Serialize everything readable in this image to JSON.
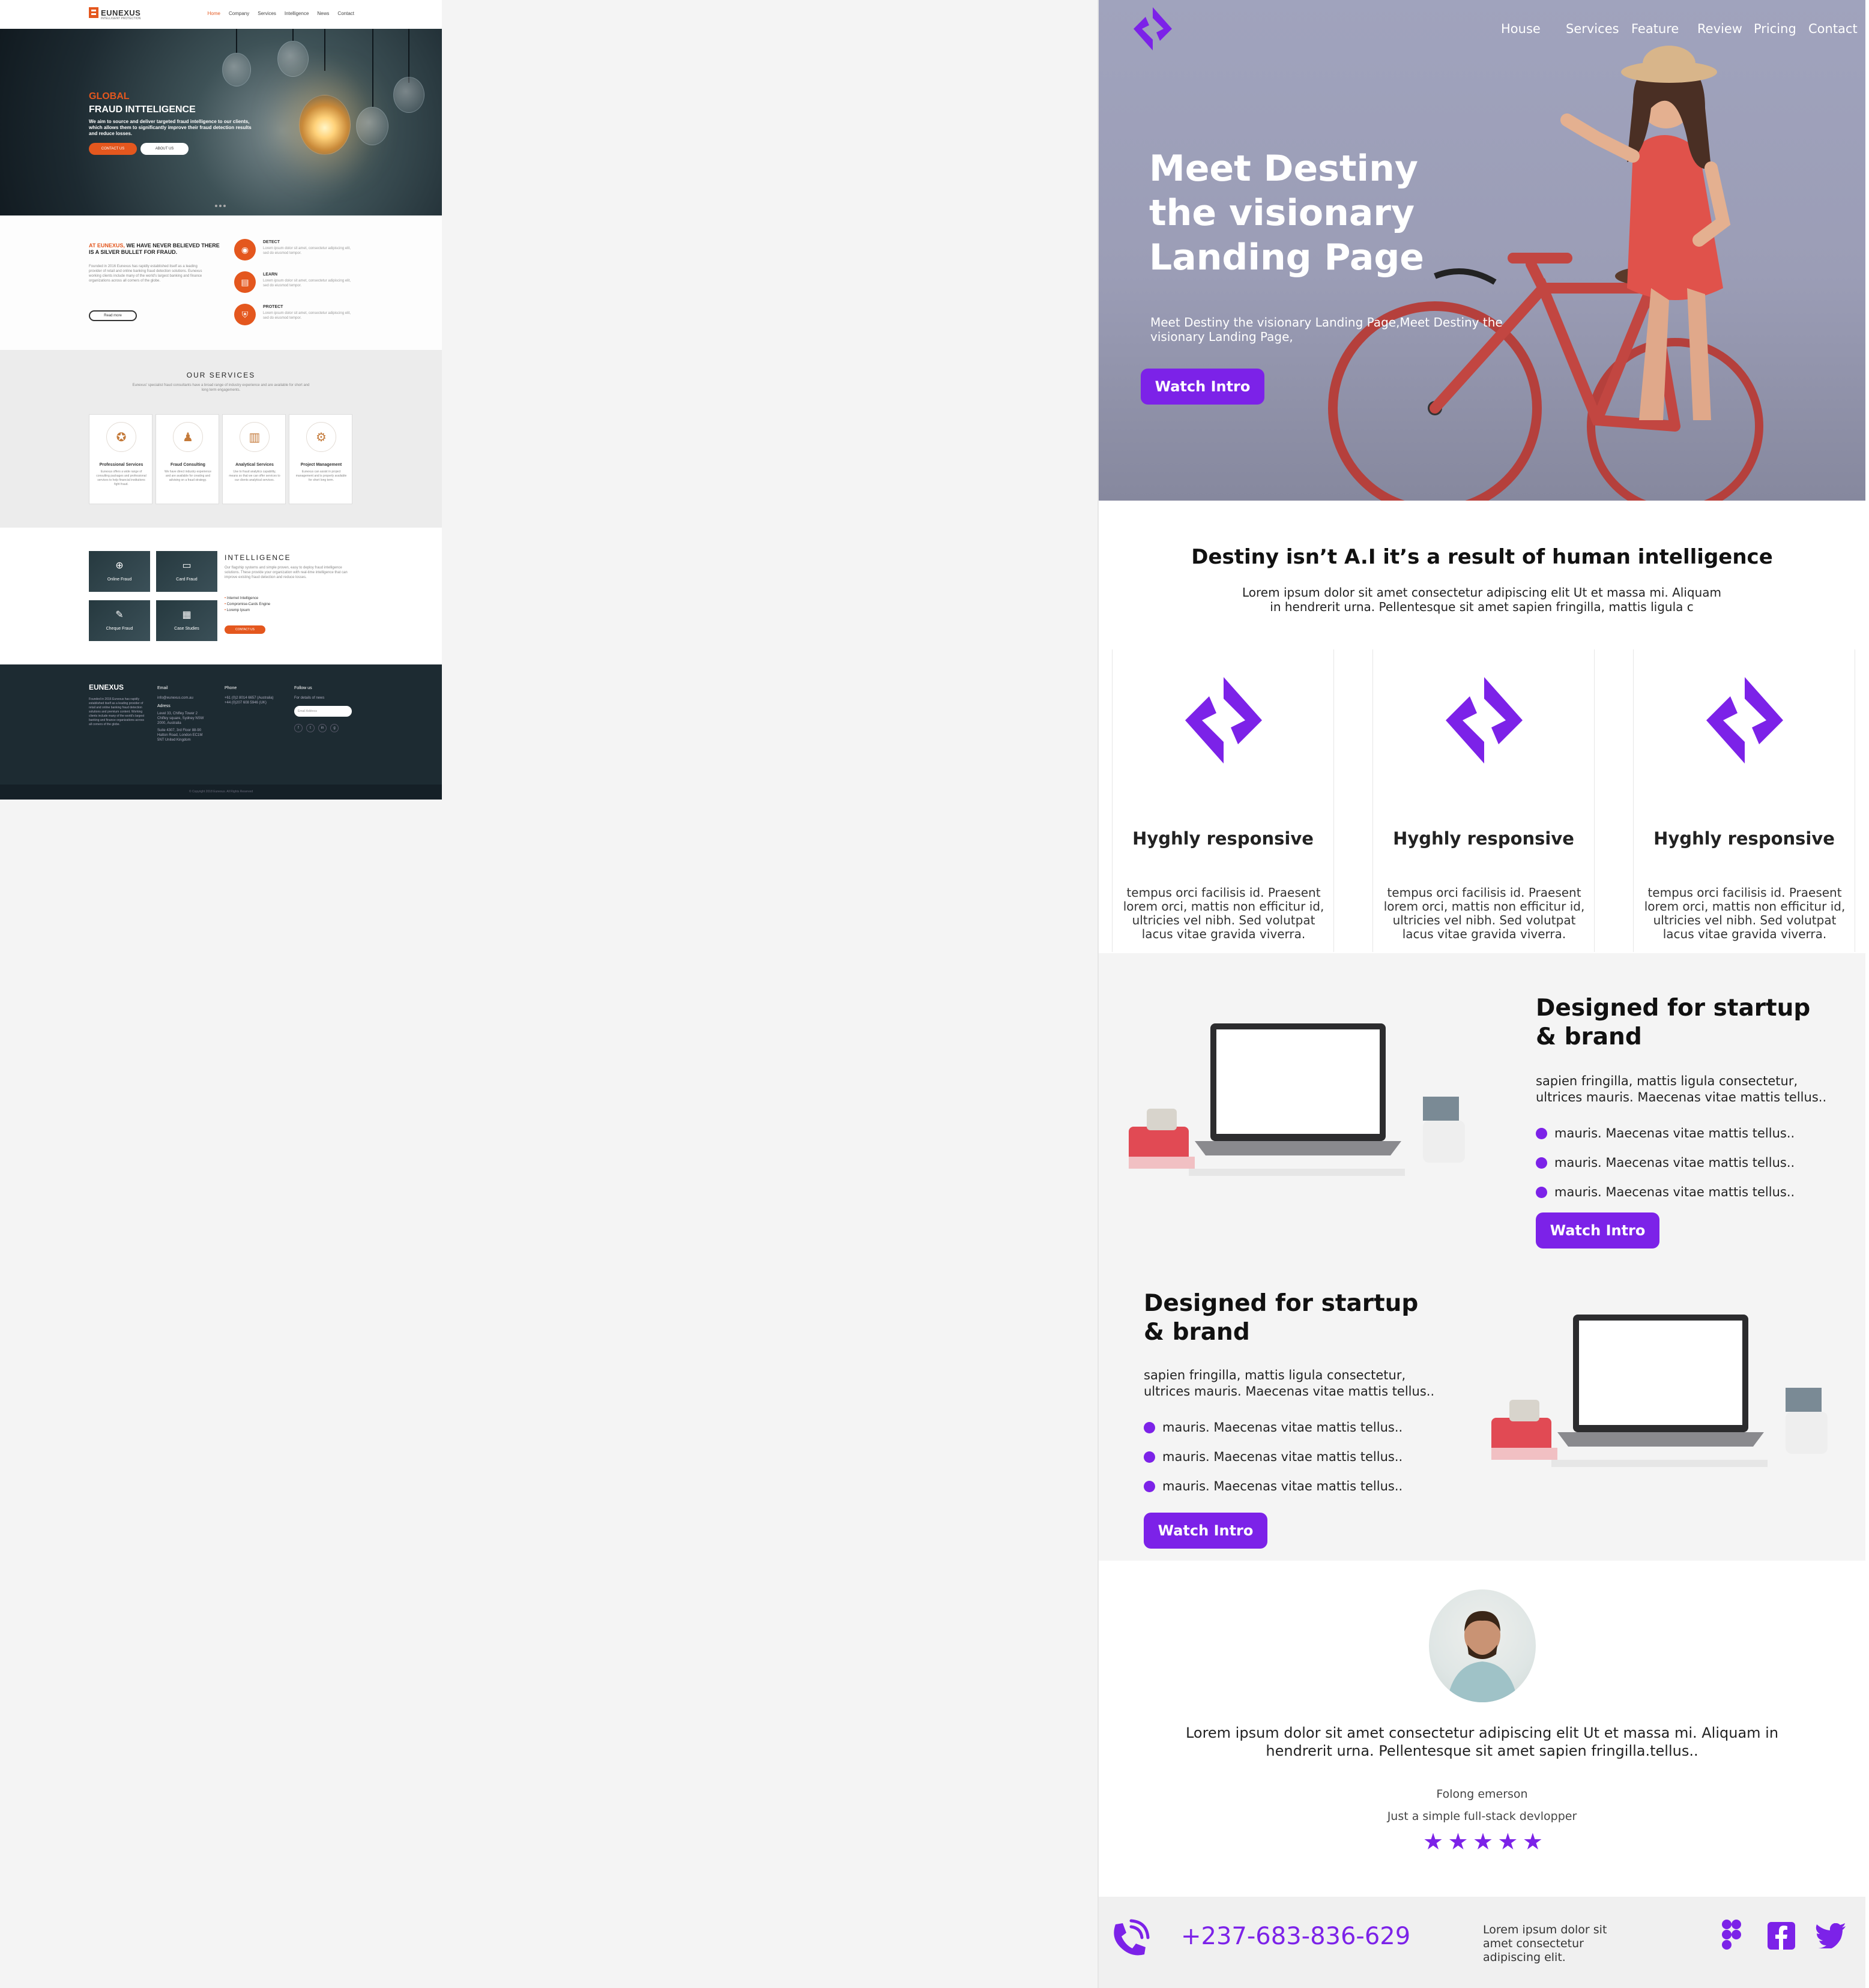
{
  "left_page": {
    "logo": {
      "name": "EUNEXUS",
      "tagline": "INTELLIGENT PROTECTION"
    },
    "nav": [
      "Home",
      "Company",
      "Services",
      "Intelligence",
      "News",
      "Contact"
    ],
    "hero": {
      "title_accent": "GLOBAL",
      "title": "FRAUD INTTELIGENCE",
      "text": "We aim to source and deliver targeted fraud intelligence to our clients, which allows them to significantly improve their fraud detection results and reduce losses.",
      "btn_contact": "CONTACT US",
      "btn_about": "ABOUT US"
    },
    "about": {
      "heading_accent": "AT EUNEXUS,",
      "heading": "WE HAVE NEVER BELIEVED THERE IS A SILVER BULLET FOR FRAUD.",
      "text": "Founded in 2016 Eunexus has rapidly established itself as a leading provider of retail and online banking fraud detection solutions. Eunexus working clients include many of the world's largest banking and finance organizations across all corners of the globe.",
      "read_more": "Read more",
      "features": [
        {
          "title": "DETECT",
          "text": "Lorem ipsum dolor sit amet, consectetur adipiscing elit, sed do eiusmod tempor."
        },
        {
          "title": "LEARN",
          "text": "Lorem ipsum dolor sit amet, consectetur adipiscing elit, sed do eiusmod tempor."
        },
        {
          "title": "PROTECT",
          "text": "Lorem ipsum dolor sit amet, consectetur adipiscing elit, sed do eiusmod tempor."
        }
      ]
    },
    "services": {
      "heading": "OUR SERVICES",
      "text": "Eunexus' specialist fraud consultants have a broad range of industry experience and are available for short and long term engagements.",
      "cards": [
        {
          "title": "Professional Services",
          "text": "Eunexus offers a wide range of consulting packages and professional services to help financial institutions fight fraud."
        },
        {
          "title": "Fraud Consulting",
          "text": "We have direct industry experience and are available for creating and advising on a fraud strategy."
        },
        {
          "title": "Analytical Services",
          "text": "Use to fraud analytics capability, means so that we can offer services to our clients analytical services."
        },
        {
          "title": "Project Management",
          "text": "Eunexus can assist in project management and is properly available for short long term."
        }
      ]
    },
    "intel": {
      "tiles": [
        "Online Fraud",
        "Card Fraud",
        "Cheque Fraud",
        "Case Studies"
      ],
      "heading": "INTELLIGENCE",
      "text": "Our flagship systems and simple proven, easy to deploy fraud intelligence solutions. These provide your organization with real-time intelligence that can improve existing fraud detection and reduce losses.",
      "list": [
        "Internet Intelligence",
        "Compromise-Cards Engine",
        "Loremp Ipsum"
      ],
      "btn": "CONTACT US"
    },
    "footer": {
      "about": "Founded in 2016 Eunexus has rapidly established itself as a leading provider of retail and online banking fraud detection solutions and premium content. Working clients include many of the world's largest banking and finance organizations across all corners of the globe.",
      "email_h": "Email",
      "email": "info@eunexus.com.au",
      "address_h": "Adress",
      "address": "Level 33, Chifley Tower 2 Chifley square, Sydney NSW 2000, Australia",
      "address2": "Suite 4307, 3rd Floor 88-90 Hatton Road, London EC1M 5NT United Kingdom",
      "phone_h": "Phone",
      "phone1": "+61 (0)2 8014 6657 (Australia)",
      "phone2": "+44 (0)207 608 5946 (UK)",
      "follow_h": "Follow us",
      "follow_p": "For details of news",
      "subscribe_ph": "Email Address",
      "social": [
        "f",
        "t",
        "in",
        "g"
      ],
      "copyright": "© Copyright 2018 Eunexus. All Rights Reserved"
    }
  },
  "right_page": {
    "nav": [
      "House",
      "Services",
      "Feature",
      "Review",
      "Pricing",
      "Contact"
    ],
    "hero": {
      "title": "Meet Destiny the visionary Landing Page",
      "text": "Meet Destiny the visionary Landing Page,Meet Destiny the visionary Landing Page,",
      "btn": "Watch Intro"
    },
    "intro": {
      "heading": "Destiny isn’t A.I it’s a result of human intelligence",
      "text": "Lorem ipsum dolor sit amet consectetur adipiscing elit Ut et massa mi. Aliquam in hendrerit urna. Pellentesque sit amet sapien fringilla, mattis ligula c"
    },
    "features": [
      {
        "title": "Hyghly responsive",
        "text": "tempus orci facilisis id. Praesent lorem orci, mattis non efficitur id, ultricies vel nibh. Sed volutpat lacus vitae gravida viverra."
      },
      {
        "title": "Hyghly responsive",
        "text": "tempus orci facilisis id. Praesent lorem orci, mattis non efficitur id, ultricies vel nibh. Sed volutpat lacus vitae gravida viverra."
      },
      {
        "title": "Hyghly responsive",
        "text": "tempus orci facilisis id. Praesent lorem orci, mattis non efficitur id, ultricies vel nibh. Sed volutpat lacus vitae gravida viverra."
      }
    ],
    "blocks": [
      {
        "title": "Designed for startup & brand",
        "text": "sapien fringilla, mattis ligula consectetur, ultrices mauris. Maecenas vitae mattis tellus..",
        "items": [
          "mauris. Maecenas vitae mattis tellus..",
          "mauris. Maecenas vitae mattis tellus..",
          "mauris. Maecenas vitae mattis tellus.."
        ],
        "btn": "Watch Intro"
      },
      {
        "title": "Designed for startup & brand",
        "text": "sapien fringilla, mattis ligula consectetur, ultrices mauris. Maecenas vitae mattis tellus..",
        "items": [
          "mauris. Maecenas vitae mattis tellus..",
          "mauris. Maecenas vitae mattis tellus..",
          "mauris. Maecenas vitae mattis tellus.."
        ],
        "btn": "Watch Intro"
      }
    ],
    "testimonial": {
      "quote": "Lorem ipsum dolor sit amet consectetur adipiscing elit Ut et massa mi. Aliquam in hendrerit urna. Pellentesque sit amet sapien fringilla.tellus..",
      "name": "Folong emerson",
      "role": "Just a simple full-stack devlopper",
      "stars": [
        "★",
        "★",
        "★",
        "★",
        "★"
      ]
    },
    "footer": {
      "phone": "+237-683-836-629",
      "text": "Lorem ipsum dolor sit amet consectetur adipiscing elit."
    }
  },
  "colors": {
    "left_accent": "#e4571e",
    "left_dark": "#1d2b32",
    "right_accent": "#7c22e8"
  },
  "icons": [
    "eunexus-logo",
    "bulb",
    "eye-icon",
    "book-icon",
    "shield-icon",
    "destiny-logo",
    "laptop-photo",
    "avatar",
    "star-icon",
    "phone-icon",
    "figma-icon",
    "facebook-icon",
    "twitter-icon"
  ]
}
